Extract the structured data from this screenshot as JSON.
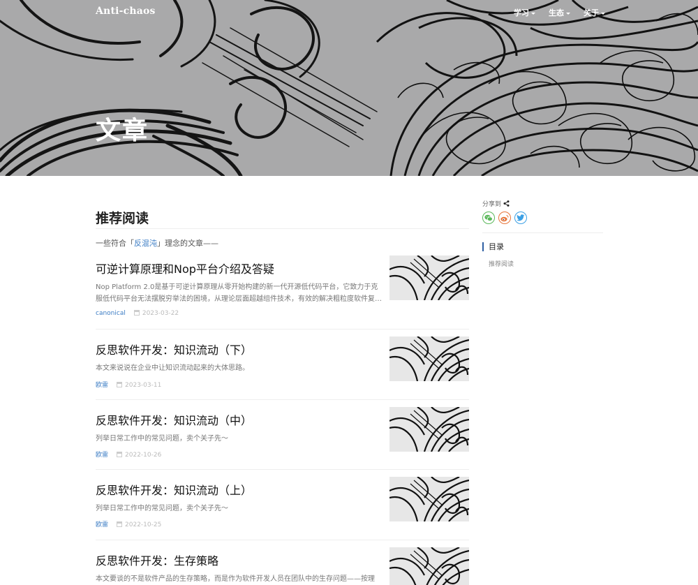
{
  "header": {
    "brand": "Anti-chaos",
    "nav": [
      {
        "label": "学习"
      },
      {
        "label": "生态"
      },
      {
        "label": "关于"
      }
    ],
    "hero_title": "文章"
  },
  "main": {
    "section_title": "推荐阅读",
    "subtitle_prefix": "一些符合「",
    "subtitle_link": "反混沌",
    "subtitle_suffix": "」理念的文章——",
    "posts": [
      {
        "title": "可逆计算原理和Nop平台介绍及答疑",
        "excerpt": "Nop Platform 2.0是基于可逆计算原理从零开始构建的新一代开源低代码平台，它致力于克服低代码平台无法摆脱穷举法的困境，从理论层面超越组件技术，有效的解决粗粒度软件复…",
        "author": "canonical",
        "date": "2023-03-22"
      },
      {
        "title": "反思软件开发：知识流动（下）",
        "excerpt": "本文来说说在企业中让知识流动起来的大体思路。",
        "author": "欧雷",
        "date": "2023-03-11"
      },
      {
        "title": "反思软件开发：知识流动（中）",
        "excerpt": "列举日常工作中的常见问题，卖个关子先～",
        "author": "欧雷",
        "date": "2022-10-26"
      },
      {
        "title": "反思软件开发：知识流动（上）",
        "excerpt": "列举日常工作中的常见问题，卖个关子先～",
        "author": "欧雷",
        "date": "2022-10-25"
      },
      {
        "title": "反思软件开发：生存策略",
        "excerpt": "本文要谈的不是软件产品的生存策略，而是作为软件开发人员在团队中的生存问题——按理",
        "author": "",
        "date": ""
      }
    ]
  },
  "sidebar": {
    "share_label": "分享到",
    "share_buttons": [
      {
        "icon": "wechat-icon",
        "color": "#5ab85a"
      },
      {
        "icon": "weibo-icon",
        "color": "#e8753a"
      },
      {
        "icon": "twitter-icon",
        "color": "#3ba0e5"
      }
    ],
    "toc_title": "目录",
    "toc_items": [
      {
        "label": "推荐阅读"
      }
    ]
  }
}
